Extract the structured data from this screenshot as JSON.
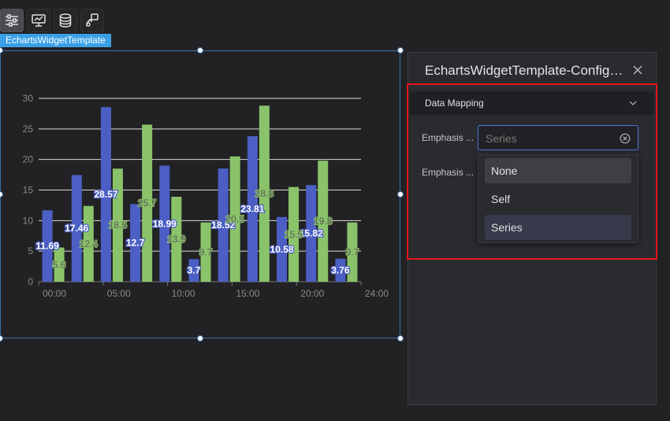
{
  "widget": {
    "name": "EchartsWidgetTemplate"
  },
  "toolbar": {
    "buttons": [
      {
        "icon": "sliders-icon"
      },
      {
        "icon": "chart-edit-icon"
      },
      {
        "icon": "database-icon"
      },
      {
        "icon": "interaction-icon"
      }
    ]
  },
  "panel": {
    "title": "EchartsWidgetTemplate-Configu…",
    "section": "Data Mapping",
    "rows": [
      {
        "label": "Emphasis ..."
      },
      {
        "label": "Emphasis ..."
      }
    ],
    "select": {
      "placeholder": "Series"
    },
    "options": [
      "None",
      "Self",
      "Series"
    ],
    "selected_option": "Series",
    "hover_option": "None"
  },
  "colors": {
    "series1": "#4b5fc5",
    "series2": "#8ac36a",
    "accent": "#3aa0e6",
    "highlight": "#e8141b"
  },
  "chart_data": {
    "type": "bar",
    "x_ticks": [
      "00:00",
      "05:00",
      "10:00",
      "15:00",
      "20:00",
      "24:00"
    ],
    "ylim": [
      0,
      30
    ],
    "y_ticks": [
      0,
      5,
      10,
      15,
      20,
      25,
      30
    ],
    "grid": true,
    "series": [
      {
        "color": "#4b5fc5",
        "values": [
          11.69,
          17.46,
          28.57,
          12.7,
          18.99,
          3.7,
          18.52,
          23.81,
          10.58,
          15.82,
          3.76
        ],
        "labels": [
          "11.69",
          "17.46",
          "28.57",
          "12.7",
          "18.99",
          "3.7",
          "18.52",
          "23.81",
          "10.58",
          "15.82",
          "3.76"
        ]
      },
      {
        "color": "#8ac36a",
        "values": [
          5.6,
          12.4,
          18.5,
          25.7,
          13.9,
          9.7,
          20.5,
          28.8,
          15.5,
          19.8,
          9.7
        ],
        "labels": [
          "5.6",
          "12.4",
          "18.5",
          "25.7",
          "13.9",
          "9.7",
          "20.5",
          "28.8",
          "15.5",
          "19.8",
          "9.7"
        ]
      }
    ]
  }
}
